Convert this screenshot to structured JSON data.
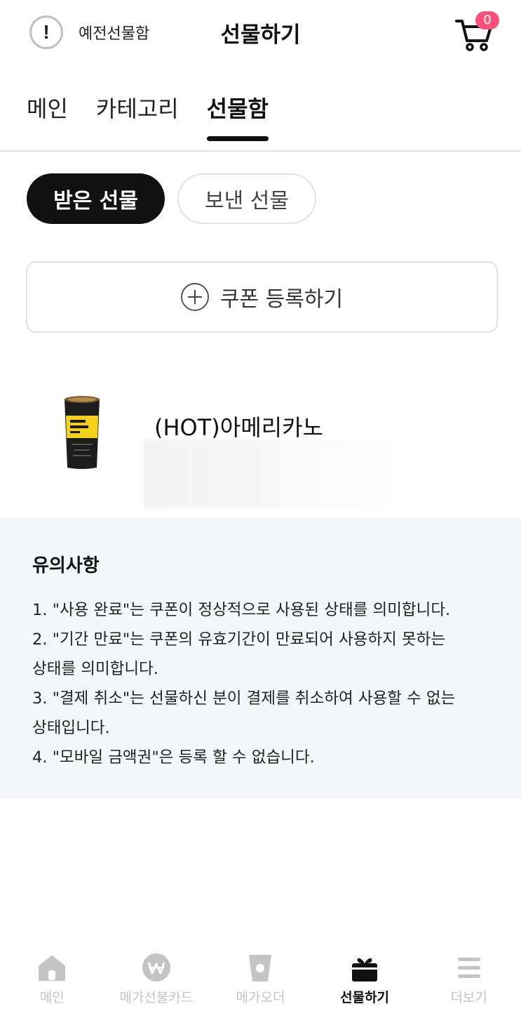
{
  "header": {
    "old_gift_label": "예전선물함",
    "title": "선물하기",
    "cart_count": "0"
  },
  "tabs": [
    {
      "label": "메인",
      "active": false
    },
    {
      "label": "카테고리",
      "active": false
    },
    {
      "label": "선물함",
      "active": true
    }
  ],
  "gift_filters": [
    {
      "label": "받은 선물",
      "selected": true
    },
    {
      "label": "보낸 선물",
      "selected": false
    }
  ],
  "coupon": {
    "register_label": "쿠폰 등록하기"
  },
  "gift_items": [
    {
      "name": "(HOT)아메리카노",
      "icon": "coffee-cup-image"
    }
  ],
  "notice": {
    "title": "유의사항",
    "items": [
      "1. \"사용 완료\"는 쿠폰이 정상적으로 사용된 상태를 의미합니다.",
      "2. \"기간 만료\"는 쿠폰의 유효기간이 만료되어 사용하지 못하는",
      "상태를 의미합니다.",
      "3. \"결제 취소\"는 선물하신 분이 결제를 취소하여 사용할 수 없는",
      "상태입니다.",
      "4. \"모바일 금액권\"은 등록 할 수 없습니다."
    ]
  },
  "bottom_nav": [
    {
      "label": "메인",
      "icon": "home-icon",
      "active": false
    },
    {
      "label": "메가선불카드",
      "icon": "won-card-icon",
      "active": false
    },
    {
      "label": "메가오더",
      "icon": "cup-icon",
      "active": false
    },
    {
      "label": "선물하기",
      "icon": "gift-icon",
      "active": true
    },
    {
      "label": "더보기",
      "icon": "menu-icon",
      "active": false
    }
  ],
  "colors": {
    "accent_dark": "#111111",
    "badge": "#ff4f7b",
    "notice_bg": "#f4f8fa",
    "inactive_nav": "#c4c4c4",
    "product_yellow": "#f4d21a"
  }
}
